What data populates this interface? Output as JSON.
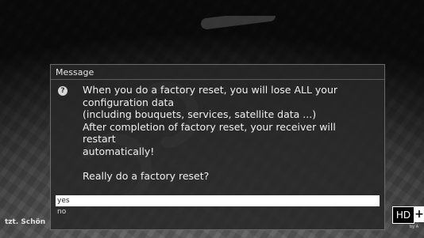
{
  "dialog": {
    "title": "Message",
    "message": "When you do a factory reset, you will lose ALL your\nconfiguration data\n(including bouquets, services, satellite data ...)\nAfter completion of factory reset, your receiver will restart\nautomatically!\n\nReally do a factory reset?",
    "options": [
      {
        "label": "yes",
        "selected": true
      },
      {
        "label": "no",
        "selected": false
      }
    ],
    "icon": "question-icon",
    "icon_glyph": "?"
  },
  "background": {
    "left_text": "tzt. Schön",
    "corner_text": "by A"
  },
  "badges": {
    "hd": "HD",
    "plus": "+"
  },
  "colors": {
    "dialog_bg": "#282828",
    "selection": "#ffffff",
    "text": "#f0f0f0"
  }
}
